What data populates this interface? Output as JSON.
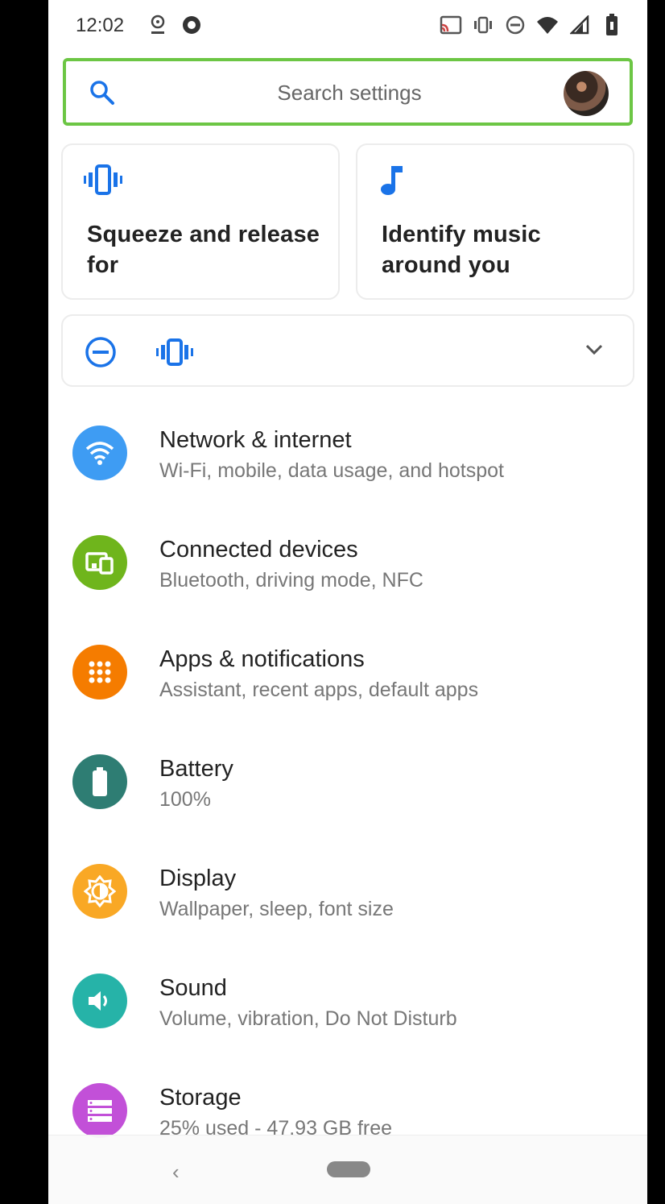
{
  "status_bar": {
    "time": "12:02",
    "left_icons": [
      "data-saver-icon",
      "app-notification-icon"
    ],
    "right_icons": [
      "cast-icon",
      "vibrate-icon",
      "dnd-icon",
      "wifi-icon",
      "signal-icon",
      "battery-icon"
    ]
  },
  "search": {
    "placeholder": "Search settings",
    "icon": "search-icon",
    "avatar": "account-avatar"
  },
  "suggestions": [
    {
      "icon": "squeeze-vibrate-icon",
      "title": "Squeeze and release for",
      "color": "#1a73e8"
    },
    {
      "icon": "music-note-icon",
      "title": "Identify music around you",
      "color": "#1a73e8"
    }
  ],
  "conditions": {
    "icons": [
      "dnd-icon",
      "vibrate-icon"
    ],
    "expand_icon": "chevron-down-icon"
  },
  "settings": [
    {
      "title": "Network & internet",
      "subtitle": "Wi-Fi, mobile, data usage, and hotspot",
      "icon": "wifi-icon",
      "color": "#3e9cf3"
    },
    {
      "title": "Connected devices",
      "subtitle": "Bluetooth, driving mode, NFC",
      "icon": "devices-icon",
      "color": "#6fb51c"
    },
    {
      "title": "Apps & notifications",
      "subtitle": "Assistant, recent apps, default apps",
      "icon": "apps-grid-icon",
      "color": "#f57c00"
    },
    {
      "title": "Battery",
      "subtitle": "100%",
      "icon": "battery-icon",
      "color": "#2e7d73"
    },
    {
      "title": "Display",
      "subtitle": "Wallpaper, sleep, font size",
      "icon": "brightness-icon",
      "color": "#f9a825"
    },
    {
      "title": "Sound",
      "subtitle": "Volume, vibration, Do Not Disturb",
      "icon": "volume-icon",
      "color": "#26b3a8"
    },
    {
      "title": "Storage",
      "subtitle": "25% used - 47.93 GB free",
      "icon": "storage-icon",
      "color": "#c250d8"
    }
  ],
  "nav_bar": {
    "back": "‹",
    "home": "home-pill"
  }
}
